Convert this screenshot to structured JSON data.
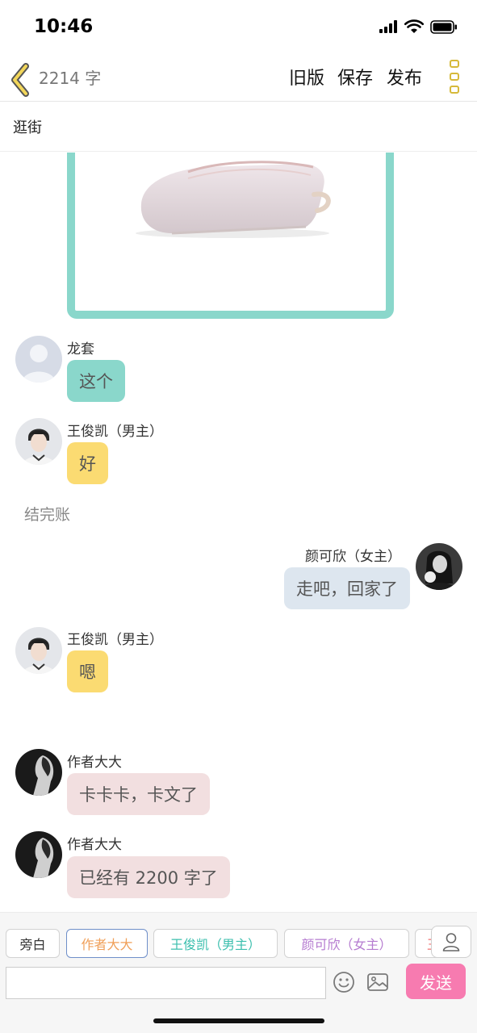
{
  "status_bar": {
    "time": "10:46",
    "icons": [
      "signal-icon",
      "wifi-icon",
      "battery-icon"
    ]
  },
  "nav": {
    "back_icon": "chevron-left-icon",
    "word_count": "2214 字",
    "old_version": "旧版",
    "save": "保存",
    "publish": "发布",
    "more_icon": "more-vertical-icon",
    "accent_color": "#d6b93a"
  },
  "chapter": {
    "title": "逛街"
  },
  "chat": {
    "image_frame_color": "#8ad7cb",
    "messages": [
      {
        "sender": "龙套",
        "text": "这个",
        "side": "left",
        "bubble_color": "#8ad7cb"
      },
      {
        "sender": "王俊凯（男主）",
        "text": "好",
        "side": "left",
        "bubble_color": "#fbdb72"
      },
      {
        "narration": "结完账"
      },
      {
        "sender": "颜可欣（女主）",
        "text": "走吧，回家了",
        "side": "right",
        "bubble_color": "#dde6ef"
      },
      {
        "sender": "王俊凯（男主）",
        "text": "嗯",
        "side": "left",
        "bubble_color": "#fbdb72"
      },
      {
        "sender": "作者大大",
        "text": "卡卡卡，卡文了",
        "side": "left",
        "bubble_color": "#f2dfe0"
      },
      {
        "sender": "作者大大",
        "text": "已经有 2200 字了",
        "side": "left",
        "bubble_color": "#f2dfe0"
      }
    ]
  },
  "composer": {
    "roles": [
      {
        "label": "旁白",
        "color": "#333333"
      },
      {
        "label": "作者大大",
        "color": "#f0a05a"
      },
      {
        "label": "王俊凯（男主）",
        "color": "#3cbfae"
      },
      {
        "label": "颜可欣（女主）",
        "color": "#b57bd0"
      },
      {
        "label": "王",
        "color": "#f07070"
      }
    ],
    "active_role_index": 1,
    "input_value": "",
    "input_placeholder": "",
    "send": "发送",
    "send_color": "#f77bb0",
    "emoji_icon": "smile-icon",
    "image_icon": "image-icon",
    "role_manage_icon": "person-icon"
  }
}
